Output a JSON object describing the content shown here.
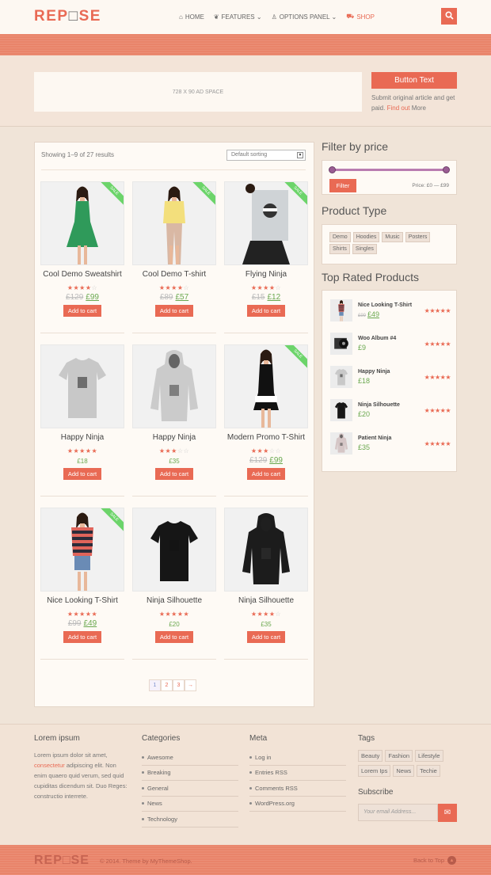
{
  "header": {
    "logo": "REP□SE",
    "logo_parts": [
      "REP",
      "□",
      "SE"
    ],
    "nav": [
      {
        "icon": "home-icon",
        "label": "HOME"
      },
      {
        "icon": "leaf-icon",
        "label": "FEATURES ⌄"
      },
      {
        "icon": "flask-icon",
        "label": "OPTIONS PANEL ⌄"
      },
      {
        "icon": "cart-icon",
        "label": "SHOP"
      }
    ],
    "search_icon": "search-icon"
  },
  "ad": {
    "text": "728 X 90 AD SPACE",
    "button": "Button Text",
    "submit_text": "Submit original article and get paid.",
    "find_out": "Find out",
    "more": "More"
  },
  "shop": {
    "showing": "Showing 1–9 of 27 results",
    "sorting": "Default sorting"
  },
  "products": [
    {
      "title": "Cool Demo Sweatshirt",
      "rating": 4,
      "old_price": "£129",
      "price": "£99",
      "sale": true,
      "button": "Add to cart",
      "image": "woman-green-dress"
    },
    {
      "title": "Cool Demo T-shirt",
      "rating": 4,
      "old_price": "£89",
      "price": "£57",
      "sale": true,
      "button": "Add to cart",
      "image": "woman-yellow-top"
    },
    {
      "title": "Flying Ninja",
      "rating": 4,
      "old_price": "£15",
      "price": "£12",
      "sale": true,
      "button": "Add to cart",
      "image": "ninja-poster"
    },
    {
      "title": "Happy Ninja",
      "rating": 5,
      "old_price": "",
      "price": "£18",
      "sale": false,
      "button": "Add to cart",
      "image": "grey-tshirt"
    },
    {
      "title": "Happy Ninja",
      "rating": 3,
      "old_price": "",
      "price": "£35",
      "sale": false,
      "button": "Add to cart",
      "image": "grey-hoodie"
    },
    {
      "title": "Modern Promo T-Shirt",
      "rating": 3,
      "old_price": "£129",
      "price": "£99",
      "sale": true,
      "button": "Add to cart",
      "image": "woman-striped-dress"
    },
    {
      "title": "Nice Looking T-Shirt",
      "rating": 5,
      "old_price": "£99",
      "price": "£49",
      "sale": true,
      "button": "Add to cart",
      "image": "woman-striped-top"
    },
    {
      "title": "Ninja Silhouette",
      "rating": 5,
      "old_price": "",
      "price": "£20",
      "sale": false,
      "button": "Add to cart",
      "image": "black-tshirt"
    },
    {
      "title": "Ninja Silhouette",
      "rating": 4,
      "old_price": "",
      "price": "£35",
      "sale": false,
      "button": "Add to cart",
      "image": "black-hoodie"
    }
  ],
  "sale_label": "SALE",
  "pagination": [
    "1",
    "2",
    "3",
    "→"
  ],
  "sidebar": {
    "filter_title": "Filter by price",
    "filter_button": "Filter",
    "price_label": "Price: £0 — £99",
    "type_title": "Product Type",
    "types": [
      "Demo",
      "Hoodies",
      "Music",
      "Posters",
      "Shirts",
      "Singles"
    ],
    "top_title": "Top Rated Products",
    "top": [
      {
        "name": "Nice Looking T-Shirt",
        "old_price": "£99",
        "price": "£49",
        "image": "woman-striped-top"
      },
      {
        "name": "Woo Album #4",
        "old_price": "",
        "price": "£9",
        "image": "album"
      },
      {
        "name": "Happy Ninja",
        "old_price": "",
        "price": "£18",
        "image": "grey-tshirt"
      },
      {
        "name": "Ninja Silhouette",
        "old_price": "",
        "price": "£20",
        "image": "black-tshirt"
      },
      {
        "name": "Patient Ninja",
        "old_price": "",
        "price": "£35",
        "image": "hoodie"
      }
    ],
    "top_rating": 5
  },
  "footer": {
    "lorem_title": "Lorem ipsum",
    "lorem_a": "Lorem ipsum dolor sit amet,",
    "lorem_link": "consectetur",
    "lorem_b": "adipiscing elit. Non enim quaero quid verum, sed quid cupiditas dicendum sit. Duo Reges: constructio interrete.",
    "cat_title": "Categories",
    "categories": [
      "Awesome",
      "Breaking",
      "General",
      "News",
      "Technology"
    ],
    "meta_title": "Meta",
    "meta": [
      "Log in",
      "Entries RSS",
      "Comments RSS",
      "WordPress.org"
    ],
    "tags_title": "Tags",
    "tags": [
      "Beauty",
      "Fashion",
      "Lifestyle",
      "Lorem Ips",
      "News",
      "Techie"
    ],
    "subscribe_title": "Subscribe",
    "email_placeholder": "Your email Address...",
    "copyright": "© 2014. Theme by MyThemeShop.",
    "back_to_top": "Back to Top"
  },
  "colors": {
    "accent": "#e96a54",
    "price": "#6aa84f",
    "sale": "#6cd46a",
    "slider": "#9a5d93"
  }
}
